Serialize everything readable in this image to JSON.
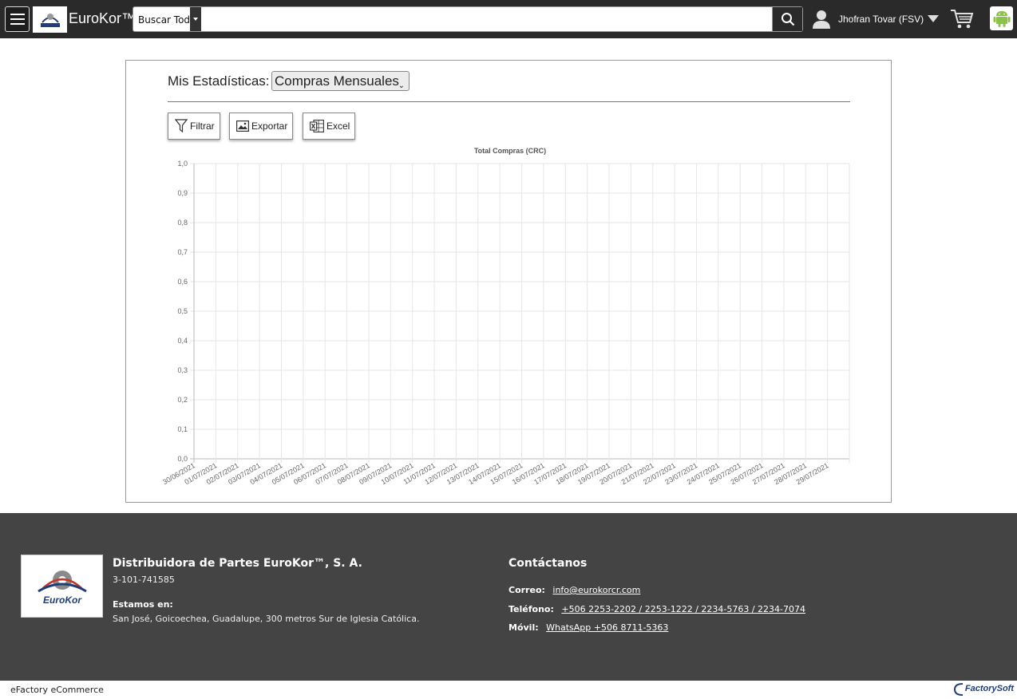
{
  "header": {
    "brand": "EuroKor™",
    "search_scope": "Buscar Todo",
    "search_placeholder": "",
    "user_name": "Jhofran Tovar (FSV)"
  },
  "stats": {
    "label": "Mis Estadísticas:",
    "selected_report": "Compras Mensuales",
    "buttons": {
      "filter": "Filtrar",
      "export": "Exportar",
      "excel": "Excel"
    }
  },
  "chart_data": {
    "type": "line",
    "title": "Total Compras (CRC)",
    "x": [
      "30/06/2021",
      "01/07/2021",
      "02/07/2021",
      "03/07/2021",
      "04/07/2021",
      "05/07/2021",
      "06/07/2021",
      "07/07/2021",
      "08/07/2021",
      "09/07/2021",
      "10/07/2021",
      "11/07/2021",
      "12/07/2021",
      "13/07/2021",
      "14/07/2021",
      "15/07/2021",
      "16/07/2021",
      "17/07/2021",
      "18/07/2021",
      "19/07/2021",
      "20/07/2021",
      "21/07/2021",
      "22/07/2021",
      "23/07/2021",
      "24/07/2021",
      "25/07/2021",
      "26/07/2021",
      "27/07/2021",
      "28/07/2021",
      "29/07/2021"
    ],
    "y_ticks": [
      "0,0",
      "0,1",
      "0,2",
      "0,3",
      "0,4",
      "0,5",
      "0,6",
      "0,7",
      "0,8",
      "0,9",
      "1,0"
    ],
    "ylim": [
      0,
      1
    ],
    "series": [],
    "grid": true
  },
  "footer": {
    "company": "Distribuidora de Partes EuroKor™, S. A.",
    "legal_id": "3-101-741585",
    "location_label": "Estamos en:",
    "location": "San José, Goicoechea, Guadalupe, 300 metros Sur de Iglesia Católica.",
    "contact_title": "Contáctanos",
    "email_label": "Correo:",
    "email": "info@eurokorcr.com",
    "phone_label": "Teléfono:",
    "phone": "+506 2253-2202 / 2253-1222 / 2234-5763 / 2234-7074",
    "mobile_label": "Móvil:",
    "mobile": "WhatsApp +506 8711-5363",
    "logo_text": "EuroKor"
  },
  "bottom": {
    "platform": "eFactory eCommerce",
    "vendor_logo": "FactorySoft"
  }
}
